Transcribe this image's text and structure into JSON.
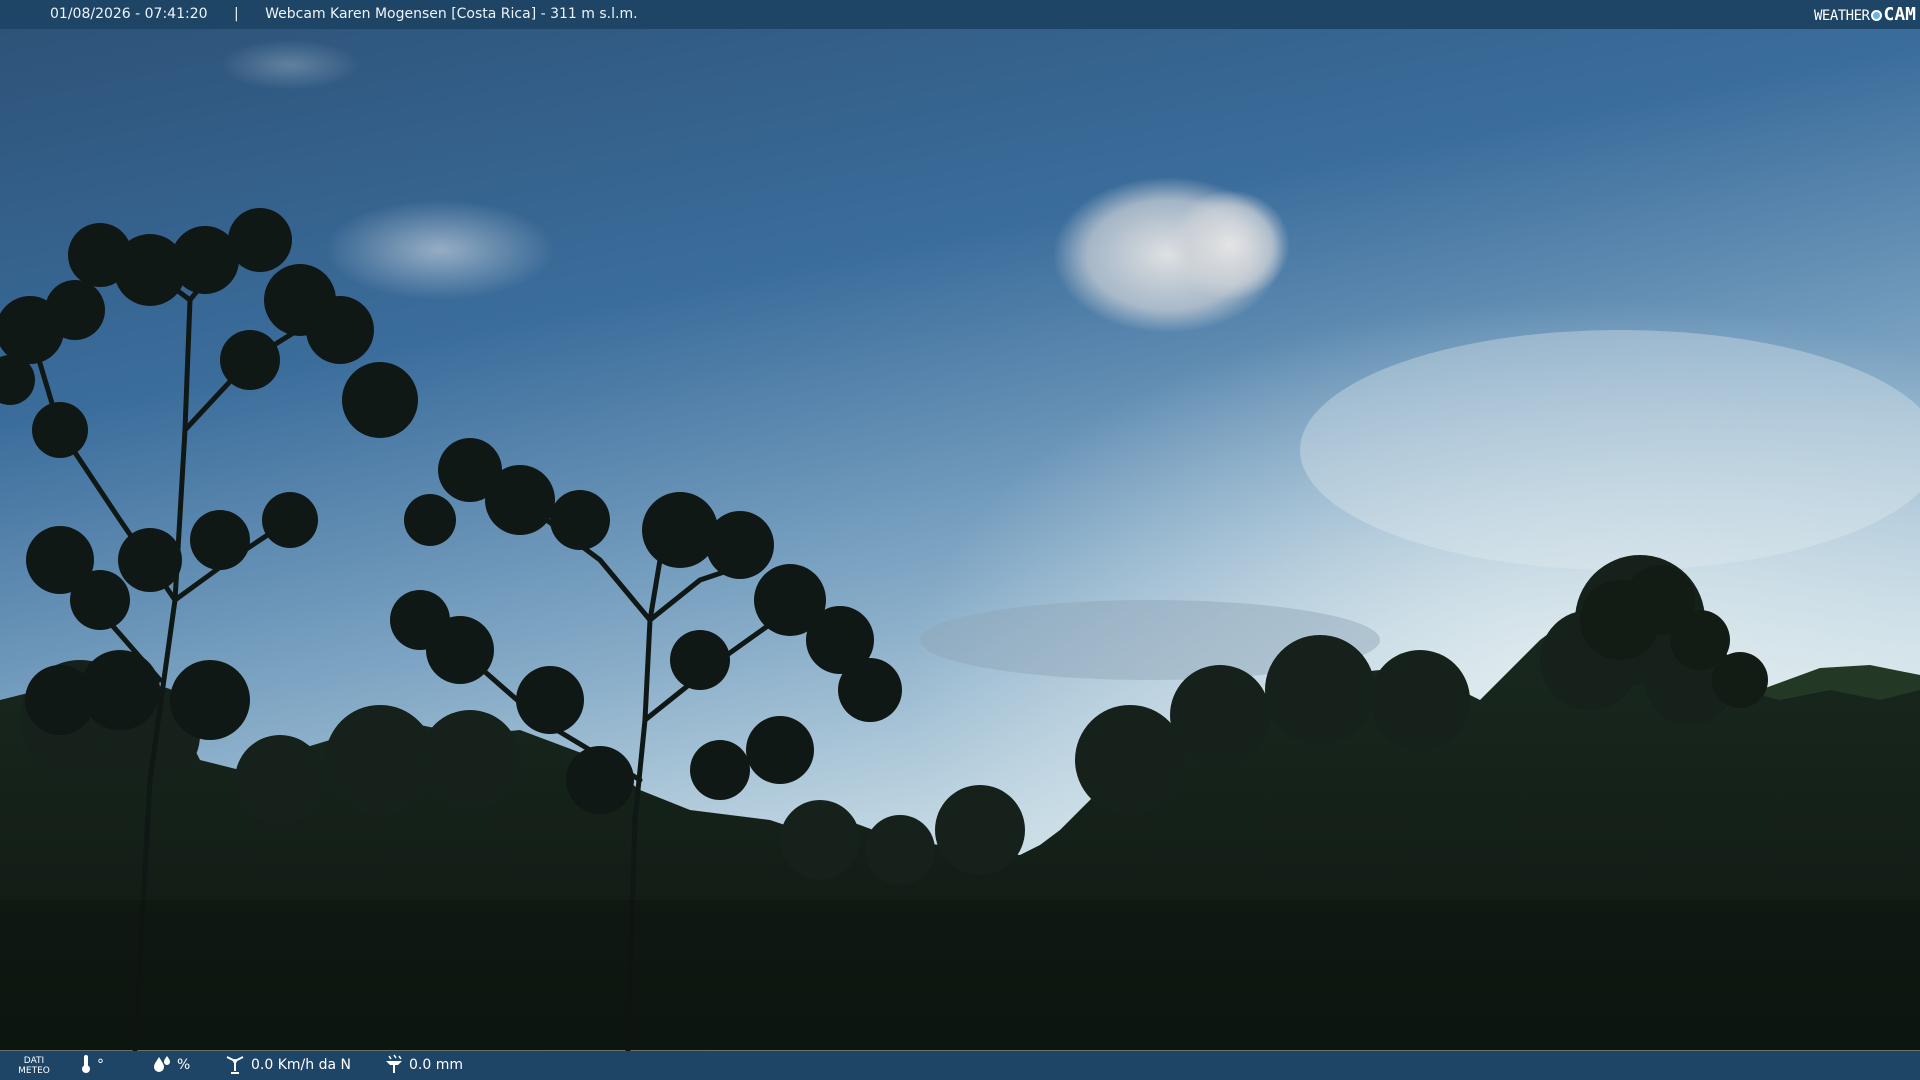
{
  "header": {
    "datetime": "01/08/2026 - 07:41:20",
    "separator": "|",
    "location": "Webcam Karen Mogensen [Costa Rica] - 311 m s.l.m."
  },
  "brand": {
    "prefix": "WEATHER",
    "suffix": "CAM"
  },
  "footer": {
    "dati_line1": "DATI",
    "dati_line2": "METEO",
    "temperature": "°",
    "humidity": "%",
    "wind": "0.0 Km/h da N",
    "rain": "0.0 mm"
  },
  "colors": {
    "bar": "#1e4466",
    "sky_top": "#2f5579",
    "sky_bottom": "#cfe0e8",
    "foliage": "#111a14"
  },
  "icons": {
    "temperature": "thermometer-icon",
    "humidity": "drops-icon",
    "wind": "wind-icon",
    "rain": "rain-gauge-icon"
  }
}
